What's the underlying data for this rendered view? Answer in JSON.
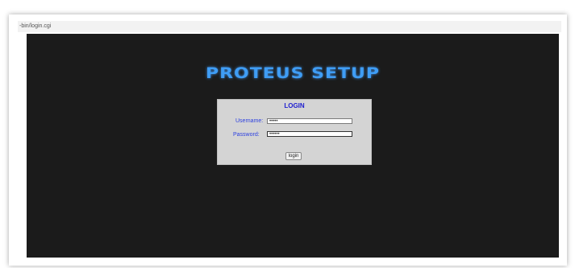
{
  "browser": {
    "url": "-bin/login.cgi"
  },
  "page": {
    "title": "PROTEUS SETUP",
    "login": {
      "heading": "LOGIN",
      "username_label": "Username:",
      "username_value": "•••••",
      "password_label": "Password:",
      "password_value": "••••••",
      "submit_label": "login"
    }
  }
}
